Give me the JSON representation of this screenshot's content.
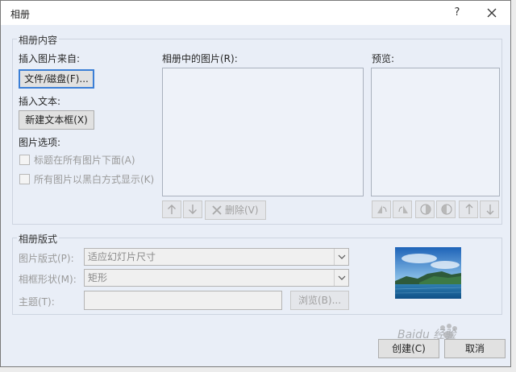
{
  "window": {
    "title": "相册",
    "help_label": "?"
  },
  "content_group": {
    "label": "相册内容",
    "insert_from_label": "插入图片来自:",
    "file_button": "文件/磁盘(F)...",
    "insert_text_label": "插入文本:",
    "new_textbox_button": "新建文本框(X)",
    "picture_options_label": "图片选项:",
    "caption_option": "标题在所有图片下面(A)",
    "blackwhite_option": "所有图片以黑白方式显示(K)",
    "pictures_list_label": "相册中的图片(R):",
    "delete_button": "删除(V)",
    "preview_label": "预览:"
  },
  "layout_group": {
    "label": "相册版式",
    "picture_layout_label": "图片版式(P):",
    "picture_layout_value": "适应幻灯片尺寸",
    "frame_shape_label": "相框形状(M):",
    "frame_shape_value": "矩形",
    "theme_label": "主题(T):",
    "theme_value": "",
    "browse_button": "浏览(B)..."
  },
  "footer": {
    "create_button": "创建(C)",
    "cancel_button": "取消"
  },
  "watermark": {
    "text": "Baidu 经验"
  },
  "colors": {
    "dialog_bg": "#e9eef7",
    "focus_border": "#3c7fd6",
    "disabled_text": "#9a9a9a"
  }
}
